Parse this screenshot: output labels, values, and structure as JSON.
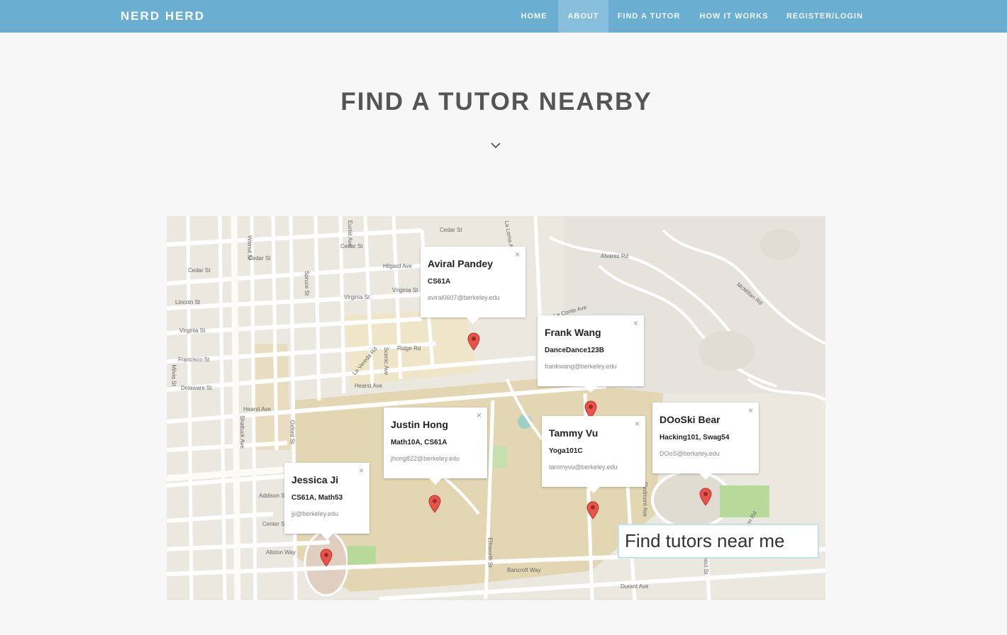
{
  "nav": {
    "brand": "NERD HERD",
    "items": [
      {
        "label": "HOME",
        "active": false
      },
      {
        "label": "ABOUT",
        "active": true
      },
      {
        "label": "FIND A TUTOR",
        "active": false
      },
      {
        "label": "HOW IT WORKS",
        "active": false
      },
      {
        "label": "REGISTER/LOGIN",
        "active": false
      }
    ]
  },
  "hero": {
    "title": "FIND A TUTOR NEARBY",
    "chevron_icon": "chevron-down-icon"
  },
  "map": {
    "street_labels": [
      "Cedar St",
      "Cedar St",
      "Cedar St",
      "Cedar St",
      "Virginia St",
      "Virginia St",
      "Virginia St",
      "Lincoln St",
      "Francisco St",
      "Delaware St",
      "Hearst Ave",
      "Hearst Ave",
      "Ridge Rd",
      "Hilgard Ave",
      "Alvarez Rd",
      "McMillan Rd",
      "Shattuck Ave",
      "Oxford St",
      "Walnut St",
      "Milvia St",
      "Bancroft Way",
      "Durant Ave",
      "Allston Way",
      "Center St",
      "Addison St",
      "Piedmont Ave",
      "Prospect St",
      "Canyon Rd",
      "Ellsworth St",
      "Euclid Ave",
      "La Loma Ave",
      "Spruce St",
      "Scenic Ave",
      "La Vereda Rd",
      "Le Conte Ave"
    ],
    "tutors": [
      {
        "name": "Aviral Pandey",
        "courses": "CS61A",
        "email": "aviral0607@berkeley.edu"
      },
      {
        "name": "Frank Wang",
        "courses": "DanceDance123B",
        "email": "frankwang@berkeley.edu"
      },
      {
        "name": "Justin Hong",
        "courses": "Math10A, CS61A",
        "email": "jhong822@berkeley.edu"
      },
      {
        "name": "Tammy Vu",
        "courses": "Yoga101C",
        "email": "tammyvu@berkeley.edu"
      },
      {
        "name": "DOoSki Bear",
        "courses": "Hacking101, Swag54",
        "email": "DOoS@berkeley.edu"
      },
      {
        "name": "Jessica Ji",
        "courses": "CS61A, Math53",
        "email": "jji@berkeley.edu"
      }
    ],
    "close_glyph": "×",
    "search_button_label": "Find tutors near me",
    "pin_icon": "map-pin-icon",
    "colors": {
      "pin": "#e8534a",
      "campus": "#e3d6b3",
      "park": "#b7d99a",
      "road": "#ffffff"
    }
  }
}
